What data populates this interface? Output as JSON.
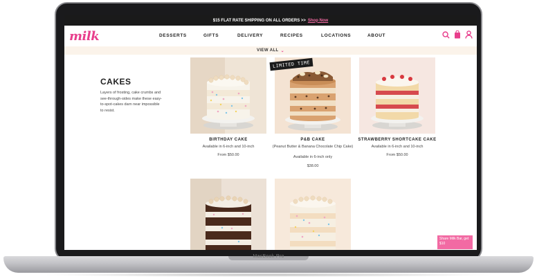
{
  "device": {
    "label": "MacBook Pro"
  },
  "promo": {
    "text": "$15 FLAT RATE SHIPPING ON ALL ORDERS >>",
    "link": "Shop Now"
  },
  "logo": {
    "text": "milk"
  },
  "nav": {
    "items": [
      "DESSERTS",
      "GIFTS",
      "DELIVERY",
      "RECIPES",
      "LOCATIONS",
      "ABOUT"
    ]
  },
  "subnav": {
    "label": "VIEW ALL"
  },
  "category": {
    "title": "CAKES",
    "description": "Layers of frosting, cake crumbs and see-through-sides make these easy-to-spot-cakes darn near impossible to resist."
  },
  "badge": {
    "text": "LIMITED TIME"
  },
  "products": [
    {
      "name": "BIRTHDAY CAKE",
      "sub": "Available in 6-inch and 10-inch",
      "price": "From $50.00"
    },
    {
      "name": "P&B CAKE",
      "sub": "(Peanut Butter & Banana Chocolate Chip Cake)",
      "sub2": "Available in 6-inch only",
      "price": "$38.00"
    },
    {
      "name": "STRAWBERRY SHORTCAKE CAKE",
      "sub": "Available in 6-inch and 10-inch",
      "price": "From $50.00"
    }
  ],
  "share": {
    "text": "Share Milk Bar, get $10"
  },
  "colors": {
    "accent": "#e83e8c",
    "promo_bg": "#1a1a1a",
    "subnav_bg": "#fbf3ea"
  }
}
